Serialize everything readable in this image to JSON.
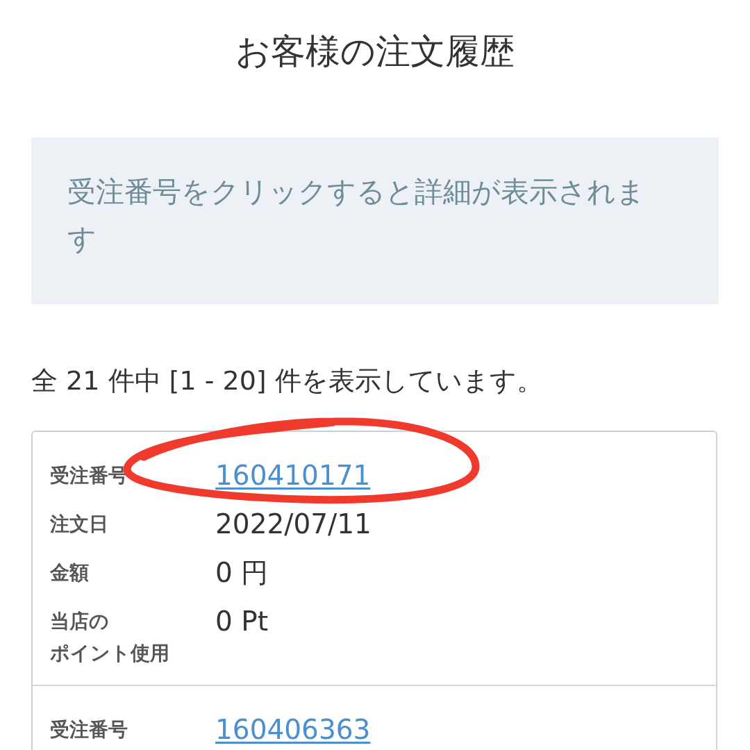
{
  "page_title": "お客様の注文履歴",
  "notice": "受注番号をクリックすると詳細が表示されます",
  "result_count": "全 21 件中 [1 - 20] 件を表示しています。",
  "orders": [
    {
      "fields": [
        {
          "label": "受注番号",
          "value": "160410171",
          "kind": "link"
        },
        {
          "label": "注文日",
          "value": "2022/07/11",
          "kind": "text"
        },
        {
          "label": "金額",
          "value": "0 円",
          "kind": "text"
        },
        {
          "label": [
            "当店の",
            "ポイント使用"
          ],
          "value": "0 Pt",
          "kind": "text"
        }
      ]
    },
    {
      "fields": [
        {
          "label": "受注番号",
          "value": "160406363",
          "kind": "link"
        }
      ]
    }
  ]
}
